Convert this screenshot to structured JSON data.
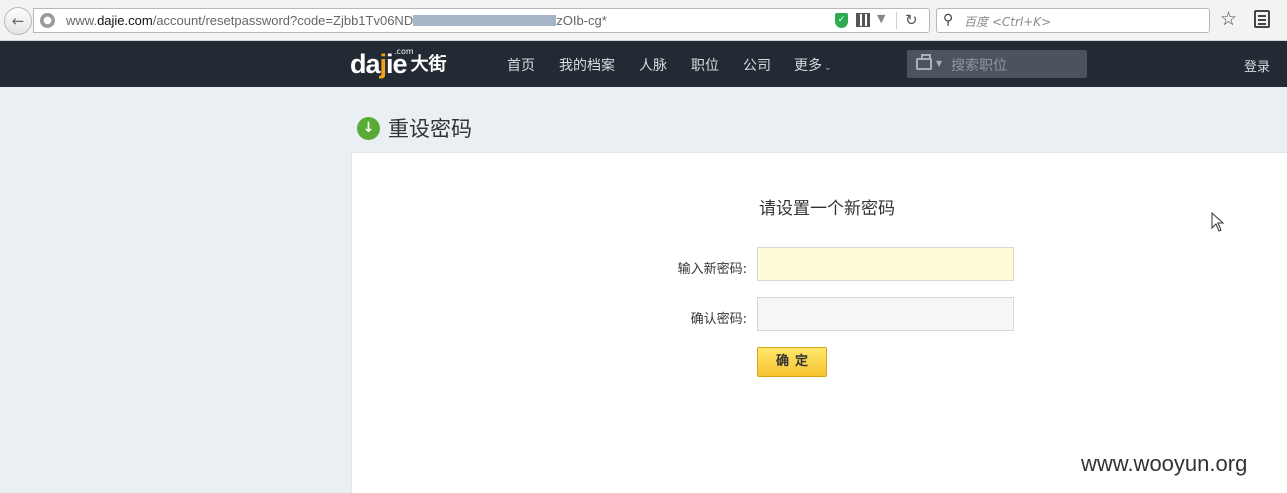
{
  "browser": {
    "url_prefix": "www.",
    "url_domain": "dajie.com",
    "url_path": "/account/resetpassword?code=Zjbb1Tv06ND",
    "url_suffix": "zOIb-cg*",
    "search_placeholder": "百度 <Ctrl+K>"
  },
  "site": {
    "logo_en_prefix": "da",
    "logo_en_j": "j",
    "logo_en_suffix": "ie",
    "logo_com": ".com",
    "logo_cn": "大街",
    "nav": [
      "首页",
      "我的档案",
      "人脉",
      "职位",
      "公司",
      "更多"
    ],
    "job_search_placeholder": "搜索职位",
    "login": "登录"
  },
  "page": {
    "title": "重设密码",
    "form_title": "请设置一个新密码",
    "new_password_label": "输入新密码:",
    "confirm_password_label": "确认密码:",
    "submit": "确定"
  },
  "watermark": "www.wooyun.org",
  "colors": {
    "nav_bg": "#222a33",
    "accent_yellow": "#f7c430",
    "icon_green": "#5aab35"
  }
}
